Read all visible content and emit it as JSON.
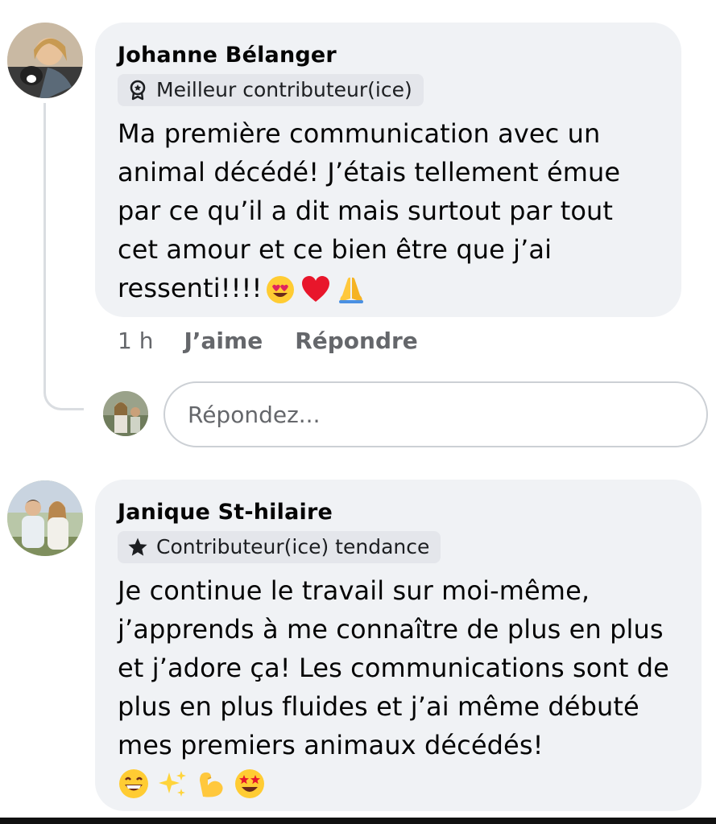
{
  "comments": [
    {
      "author": "Johanne Bélanger",
      "badge": "Meilleur contributeur(ice)",
      "badge_icon": "award-icon",
      "text": "Ma première communication avec un animal décédé! J’étais tellement émue par ce qu’il a dit mais surtout par tout cet amour et ce bien être que j’ai ressenti!!!!",
      "emojis": [
        "heart-eyes-emoji",
        "red-heart-emoji",
        "folded-hands-emoji"
      ],
      "time": "1 h",
      "like_label": "J’aime",
      "reply_label": "Répondre"
    },
    {
      "author": "Janique St-hilaire",
      "badge": "Contributeur(ice) tendance",
      "badge_icon": "star-icon",
      "text": "Je continue le travail sur moi-même, j’apprends à me connaître de plus en plus et j’adore ça! Les communications sont de plus en plus fluides et j’ai même débuté mes premiers animaux décédés!",
      "emojis": [
        "grinning-emoji",
        "sparkles-emoji",
        "flexed-biceps-emoji",
        "star-struck-emoji"
      ]
    }
  ],
  "reply_input": {
    "placeholder": "Répondez...",
    "value": ""
  },
  "colors": {
    "bubble": "#f0f2f5",
    "badge": "#e4e6eb",
    "meta_text": "#65676b",
    "text": "#050505"
  }
}
